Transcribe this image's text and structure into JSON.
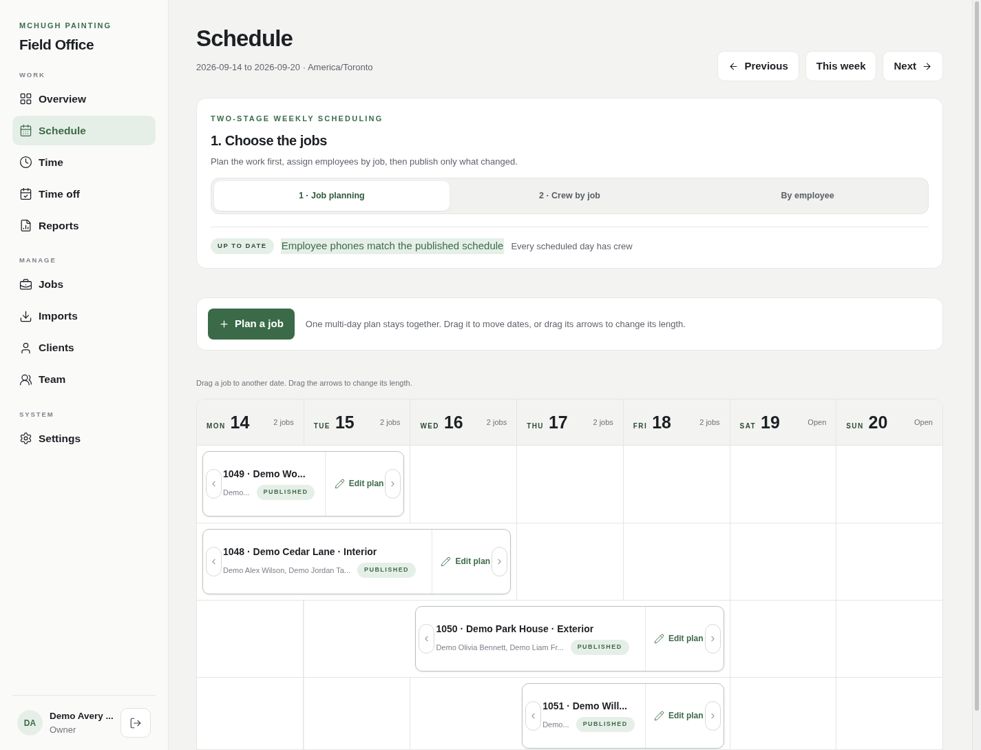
{
  "sidebar": {
    "company": "MCHUGH PAINTING",
    "app_name": "Field Office",
    "sections": [
      {
        "heading": "WORK",
        "items": [
          {
            "label": "Overview",
            "selected": false
          },
          {
            "label": "Schedule",
            "selected": true
          },
          {
            "label": "Time",
            "selected": false
          },
          {
            "label": "Time off",
            "selected": false
          },
          {
            "label": "Reports",
            "selected": false
          }
        ]
      },
      {
        "heading": "MANAGE",
        "items": [
          {
            "label": "Jobs",
            "selected": false
          },
          {
            "label": "Imports",
            "selected": false
          },
          {
            "label": "Clients",
            "selected": false
          },
          {
            "label": "Team",
            "selected": false
          }
        ]
      },
      {
        "heading": "SYSTEM",
        "items": [
          {
            "label": "Settings",
            "selected": false
          }
        ]
      }
    ],
    "user": {
      "initials": "DA",
      "name": "Demo Avery ...",
      "role": "Owner"
    }
  },
  "header": {
    "title": "Schedule",
    "subtitle": "2026-09-14 to 2026-09-20 · America/Toronto",
    "buttons": [
      {
        "label": "Previous",
        "kind": "prev"
      },
      {
        "label": "This week",
        "kind": "plain"
      },
      {
        "label": "Next",
        "kind": "next"
      }
    ]
  },
  "stage_card": {
    "eyebrow": "TWO-STAGE WEEKLY SCHEDULING",
    "title": "1. Choose the jobs",
    "description": "Plan the work first, assign employees by job, then publish only what changed.",
    "tabs": [
      {
        "label": "1 · Job planning",
        "selected": true
      },
      {
        "label": "2 · Crew by job",
        "selected": false
      },
      {
        "label": "By employee",
        "selected": false
      }
    ],
    "status_badge": "UP TO DATE",
    "status_message": "Employee phones match the published schedule",
    "status_note": "Every scheduled day has crew"
  },
  "plan_bar": {
    "button": "Plan a job",
    "hint": "One multi-day plan stays together. Drag it to move dates, or drag its arrows to change its length."
  },
  "calendar": {
    "hint": "Drag a job to another date. Drag the arrows to change its length.",
    "days": [
      {
        "weekday": "MON",
        "date": "14",
        "count": "2 jobs"
      },
      {
        "weekday": "TUE",
        "date": "15",
        "count": "2 jobs"
      },
      {
        "weekday": "WED",
        "date": "16",
        "count": "2 jobs"
      },
      {
        "weekday": "THU",
        "date": "17",
        "count": "2 jobs"
      },
      {
        "weekday": "FRI",
        "date": "18",
        "count": "2 jobs"
      },
      {
        "weekday": "SAT",
        "date": "19",
        "count": "Open"
      },
      {
        "weekday": "SUN",
        "date": "20",
        "count": "Open"
      }
    ],
    "jobs": [
      {
        "title": "1049 · Demo Wo...",
        "crew": "Demo...",
        "status": "PUBLISHED",
        "action": "Edit plan",
        "covers": [
          true,
          true,
          false,
          false,
          false,
          false,
          false
        ]
      },
      {
        "title": "1048 · Demo Cedar Lane · Interior",
        "crew": "Demo Alex Wilson, Demo Jordan Ta...",
        "status": "PUBLISHED",
        "action": "Edit plan",
        "covers": [
          true,
          true,
          true,
          false,
          false,
          false,
          false
        ]
      },
      {
        "title": "1050 · Demo Park House · Exterior",
        "crew": "Demo Olivia Bennett, Demo Liam Fr...",
        "status": "PUBLISHED",
        "action": "Edit plan",
        "covers": [
          false,
          false,
          true,
          true,
          true,
          false,
          false
        ]
      },
      {
        "title": "1051 · Demo Will...",
        "crew": "Demo...",
        "status": "PUBLISHED",
        "action": "Edit plan",
        "covers": [
          false,
          false,
          false,
          true,
          true,
          false,
          false
        ]
      }
    ]
  }
}
